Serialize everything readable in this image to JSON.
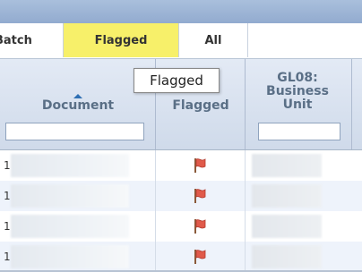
{
  "tabs": [
    {
      "label": "Batch",
      "active": false
    },
    {
      "label": "Flagged",
      "active": true
    },
    {
      "label": "All",
      "active": false
    }
  ],
  "columns": {
    "document": {
      "label": "Document",
      "sorted": "ascending",
      "filter_value": ""
    },
    "flagged": {
      "label": "Flagged"
    },
    "gl08": {
      "label_line1": "GL08:",
      "label_line2": "Business",
      "label_line3": "Unit",
      "filter_value": ""
    }
  },
  "tooltip": {
    "text": "Flagged"
  },
  "rows": [
    {
      "stub": "1",
      "flagged": true
    },
    {
      "stub": "1",
      "flagged": true
    },
    {
      "stub": "1",
      "flagged": true
    },
    {
      "stub": "1",
      "flagged": true
    }
  ],
  "colors": {
    "active_tab": "#f7f06a",
    "header_text": "#5a6f86",
    "flag": "#e05a4a"
  },
  "icons": {
    "flag": "flag-icon",
    "sort": "sort-ascending-icon"
  }
}
